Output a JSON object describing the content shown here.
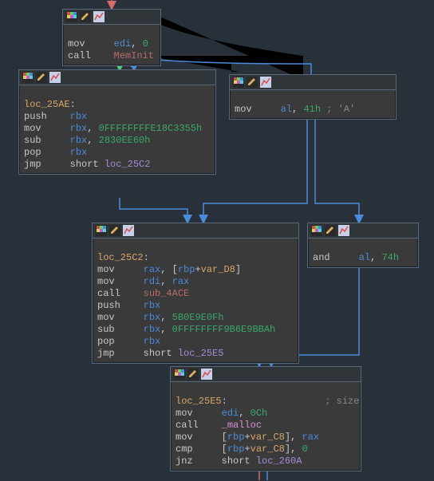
{
  "chart_data": {
    "type": "control-flow-graph",
    "nodes": [
      "block0",
      "block1",
      "block2",
      "block3",
      "block4",
      "block5"
    ],
    "edges": [
      {
        "from": "block0",
        "to": "block1",
        "color": "green"
      },
      {
        "from": "block0",
        "to": "block2",
        "color": "blue"
      },
      {
        "from": "block1",
        "to": "block3",
        "color": "blue"
      },
      {
        "from": "block2",
        "to": "block4",
        "color": "blue"
      },
      {
        "from": "block2",
        "to": "block3",
        "color": "blue"
      },
      {
        "from": "block3",
        "to": "block5",
        "color": "blue"
      },
      {
        "from": "block4",
        "to": "block5",
        "color": "blue"
      },
      {
        "from": "above",
        "to": "block0",
        "color": "red"
      }
    ]
  },
  "block0": {
    "l1_mnem": "mov",
    "l1_op1": "edi",
    "l1_sep": ", ",
    "l1_op2": "0",
    "l2_mnem": "call",
    "l2_target": "MemInit"
  },
  "block1": {
    "label": "loc_25AE",
    "label_colon": ":",
    "l1_mnem": "push",
    "l1_op1": "rbx",
    "l2_mnem": "mov",
    "l2_op1": "rbx",
    "l2_sep": ", ",
    "l2_op2": "0FFFFFFFFE18C3355h",
    "l3_mnem": "sub",
    "l3_op1": "rbx",
    "l3_sep": ", ",
    "l3_op2": "2830EE60h",
    "l4_mnem": "pop",
    "l4_op1": "rbx",
    "l5_mnem": "jmp",
    "l5_pre": "short ",
    "l5_target": "loc_25C2"
  },
  "block2": {
    "l1_mnem": "mov",
    "l1_op1": "al",
    "l1_sep": ", ",
    "l1_op2": "41h",
    "l1_cmt": " ; 'A'"
  },
  "block3": {
    "label": "loc_25C2",
    "label_colon": ":",
    "l1_mnem": "mov",
    "l1_op1": "rax",
    "l1_sep": ", [",
    "l1_op2": "rbp",
    "l1_plus": "+",
    "l1_var": "var_D8",
    "l1_close": "]",
    "l2_mnem": "mov",
    "l2_op1": "rdi",
    "l2_sep": ", ",
    "l2_op2": "rax",
    "l3_mnem": "call",
    "l3_target": "sub_4ACE",
    "l4_mnem": "push",
    "l4_op1": "rbx",
    "l5_mnem": "mov",
    "l5_op1": "rbx",
    "l5_sep": ", ",
    "l5_op2": "5B0E9E0Fh",
    "l6_mnem": "sub",
    "l6_op1": "rbx",
    "l6_sep": ", ",
    "l6_op2": "0FFFFFFFF9B6E9BBAh",
    "l7_mnem": "pop",
    "l7_op1": "rbx",
    "l8_mnem": "jmp",
    "l8_pre": "short ",
    "l8_target": "loc_25E5"
  },
  "block4": {
    "l1_mnem": "and",
    "l1_op1": "al",
    "l1_sep": ", ",
    "l1_op2": "74h"
  },
  "block5": {
    "label": "loc_25E5",
    "label_colon": ":",
    "cmt": "; size",
    "l1_mnem": "mov",
    "l1_op1": "edi",
    "l1_sep": ", ",
    "l1_op2": "0Ch",
    "l2_mnem": "call",
    "l2_target": "_malloc",
    "l3_mnem": "mov",
    "l3_op1a": "[",
    "l3_op1b": "rbp",
    "l3_plus": "+",
    "l3_var": "var_C8",
    "l3_close": "], ",
    "l3_op2": "rax",
    "l4_mnem": "cmp",
    "l4_op1a": "[",
    "l4_op1b": "rbp",
    "l4_plus": "+",
    "l4_var": "var_C8",
    "l4_close": "], ",
    "l4_op2": "0",
    "l5_mnem": "jnz",
    "l5_pre": "short ",
    "l5_target": "loc_260A"
  }
}
